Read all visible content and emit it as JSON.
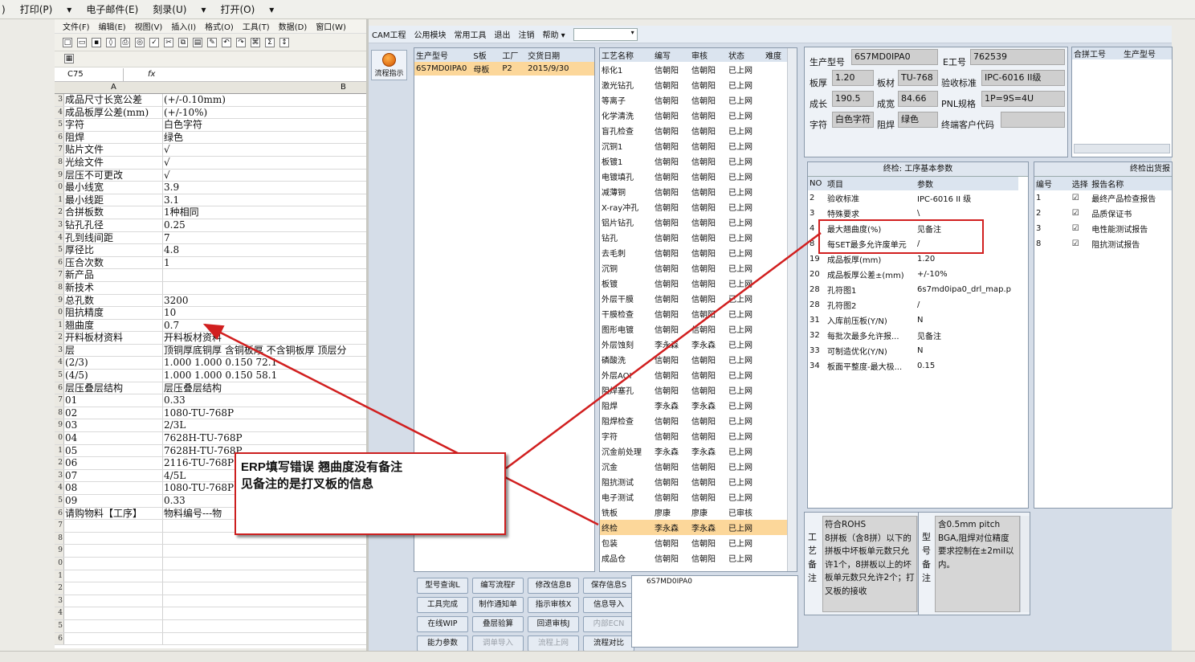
{
  "topbar": {
    "items": [
      ")",
      "打印(P)",
      "▾",
      "电子邮件(E)",
      "刻录(U)",
      "▾",
      "打开(O)",
      "▾"
    ]
  },
  "excel": {
    "menu": [
      "文件(F)",
      "编辑(E)",
      "视图(V)",
      "插入(I)",
      "格式(O)",
      "工具(T)",
      "数据(D)",
      "窗口(W)"
    ],
    "namebox": "C75",
    "fx": "fx",
    "col_a": "A",
    "col_b": "B",
    "rows": [
      {
        "n": "3",
        "a": "成品尺寸长宽公差",
        "b": "(+/-0.10mm)"
      },
      {
        "n": "4",
        "a": "成品板厚公差(mm)",
        "b": "(+/-10%)"
      },
      {
        "n": "5",
        "a": "字符",
        "b": "白色字符"
      },
      {
        "n": "6",
        "a": "阻焊",
        "b": "绿色"
      },
      {
        "n": "7",
        "a": "贴片文件",
        "b": "√"
      },
      {
        "n": "8",
        "a": "光绘文件",
        "b": "√"
      },
      {
        "n": "9",
        "a": "层压不可更改",
        "b": "√"
      },
      {
        "n": "0",
        "a": "最小线宽",
        "b": "3.9"
      },
      {
        "n": "1",
        "a": "最小线距",
        "b": "3.1"
      },
      {
        "n": "2",
        "a": "合拼板数",
        "b": "1种相同"
      },
      {
        "n": "3",
        "a": "钻孔孔径",
        "b": "0.25"
      },
      {
        "n": "4",
        "a": "孔到线间距",
        "b": "7"
      },
      {
        "n": "5",
        "a": "厚径比",
        "b": "4.8"
      },
      {
        "n": "6",
        "a": "压合次数",
        "b": "1"
      },
      {
        "n": "7",
        "a": "新产品",
        "b": ""
      },
      {
        "n": "8",
        "a": "新技术",
        "b": ""
      },
      {
        "n": "9",
        "a": "总孔数",
        "b": "3200"
      },
      {
        "n": "0",
        "a": "阻抗精度",
        "b": "10"
      },
      {
        "n": "1",
        "a": "翘曲度",
        "b": "0.7"
      },
      {
        "n": "2",
        "a": "开料板材资料",
        "b": "开料板材资料"
      },
      {
        "n": "3",
        "a": "层",
        "b": "顶铜厚底铜厚 含铜板厚 不含铜板厚 顶层分"
      },
      {
        "n": "4",
        "a": "(2/3)",
        "b": "1.000  1.000        0.150        72.1"
      },
      {
        "n": "5",
        "a": "(4/5)",
        "b": "1.000  1.000        0.150        58.1"
      },
      {
        "n": "6",
        "a": "层压叠层结构",
        "b": "层压叠层结构"
      },
      {
        "n": "7",
        "a": "01",
        "b": "0.33"
      },
      {
        "n": "8",
        "a": "02",
        "b": "1080-TU-768P"
      },
      {
        "n": "9",
        "a": "03",
        "b": "2/3L"
      },
      {
        "n": "0",
        "a": "04",
        "b": "7628H-TU-768P"
      },
      {
        "n": "1",
        "a": "05",
        "b": "7628H-TU-768P"
      },
      {
        "n": "2",
        "a": "06",
        "b": "2116-TU-768P"
      },
      {
        "n": "3",
        "a": "07",
        "b": "4/5L"
      },
      {
        "n": "4",
        "a": "08",
        "b": "1080-TU-768P"
      },
      {
        "n": "5",
        "a": "09",
        "b": "0.33"
      },
      {
        "n": "6",
        "a": "请购物料【工序】",
        "b": "物料编号---物"
      },
      {
        "n": "7",
        "a": "",
        "b": ""
      },
      {
        "n": "8",
        "a": "",
        "b": ""
      },
      {
        "n": "9",
        "a": "",
        "b": ""
      },
      {
        "n": "0",
        "a": "",
        "b": ""
      },
      {
        "n": "1",
        "a": "",
        "b": ""
      },
      {
        "n": "2",
        "a": "",
        "b": ""
      },
      {
        "n": "3",
        "a": "",
        "b": ""
      },
      {
        "n": "4",
        "a": "",
        "b": ""
      },
      {
        "n": "5",
        "a": "",
        "b": ""
      },
      {
        "n": "6",
        "a": "",
        "b": ""
      }
    ]
  },
  "cam": {
    "menu": [
      "CAM工程",
      "公用模块",
      "常用工具",
      "退出",
      "注销",
      "帮助 ▾"
    ],
    "flow_btn": "流程指示",
    "orders": {
      "headers": [
        "生产型号",
        "S板",
        "工厂",
        "交货日期"
      ],
      "rows": [
        [
          "6S7MD0IPA0",
          "母板",
          "P2",
          "2015/9/30"
        ]
      ]
    },
    "process": {
      "headers": [
        "工艺名称",
        "编写",
        "审核",
        "状态",
        "难度"
      ],
      "rows": [
        [
          "标化1",
          "信朝阳",
          "信朝阳",
          "已上网",
          ""
        ],
        [
          "激光钻孔",
          "信朝阳",
          "信朝阳",
          "已上网",
          ""
        ],
        [
          "等离子",
          "信朝阳",
          "信朝阳",
          "已上网",
          ""
        ],
        [
          "化学清洗",
          "信朝阳",
          "信朝阳",
          "已上网",
          ""
        ],
        [
          "盲孔检查",
          "信朝阳",
          "信朝阳",
          "已上网",
          ""
        ],
        [
          "沉铜1",
          "信朝阳",
          "信朝阳",
          "已上网",
          ""
        ],
        [
          "板镀1",
          "信朝阳",
          "信朝阳",
          "已上网",
          ""
        ],
        [
          "电镀填孔",
          "信朝阳",
          "信朝阳",
          "已上网",
          ""
        ],
        [
          "减薄铜",
          "信朝阳",
          "信朝阳",
          "已上网",
          ""
        ],
        [
          "X-ray冲孔",
          "信朝阳",
          "信朝阳",
          "已上网",
          ""
        ],
        [
          "铝片钻孔",
          "信朝阳",
          "信朝阳",
          "已上网",
          ""
        ],
        [
          "钻孔",
          "信朝阳",
          "信朝阳",
          "已上网",
          ""
        ],
        [
          "去毛刺",
          "信朝阳",
          "信朝阳",
          "已上网",
          ""
        ],
        [
          "沉铜",
          "信朝阳",
          "信朝阳",
          "已上网",
          ""
        ],
        [
          "板镀",
          "信朝阳",
          "信朝阳",
          "已上网",
          ""
        ],
        [
          "外层干膜",
          "信朝阳",
          "信朝阳",
          "已上网",
          ""
        ],
        [
          "干膜检查",
          "信朝阳",
          "信朝阳",
          "已上网",
          ""
        ],
        [
          "图形电镀",
          "信朝阳",
          "信朝阳",
          "已上网",
          ""
        ],
        [
          "外层蚀刻",
          "李永森",
          "李永森",
          "已上网",
          ""
        ],
        [
          "磷酸洗",
          "信朝阳",
          "信朝阳",
          "已上网",
          ""
        ],
        [
          "外层AOI",
          "信朝阳",
          "信朝阳",
          "已上网",
          ""
        ],
        [
          "阻焊塞孔",
          "信朝阳",
          "信朝阳",
          "已上网",
          ""
        ],
        [
          "阻焊",
          "李永森",
          "李永森",
          "已上网",
          ""
        ],
        [
          "阻焊检查",
          "信朝阳",
          "信朝阳",
          "已上网",
          ""
        ],
        [
          "字符",
          "信朝阳",
          "信朝阳",
          "已上网",
          ""
        ],
        [
          "沉金前处理",
          "李永森",
          "李永森",
          "已上网",
          ""
        ],
        [
          "沉金",
          "信朝阳",
          "信朝阳",
          "已上网",
          ""
        ],
        [
          "阻抗测试",
          "信朝阳",
          "信朝阳",
          "已上网",
          ""
        ],
        [
          "电子测试",
          "信朝阳",
          "信朝阳",
          "已上网",
          ""
        ],
        [
          "铣板",
          "廖康",
          "廖康",
          "已审核",
          ""
        ],
        [
          "终检",
          "李永森",
          "李永森",
          "已上网",
          ""
        ],
        [
          "包装",
          "信朝阳",
          "信朝阳",
          "已上网",
          ""
        ],
        [
          "成品仓",
          "信朝阳",
          "信朝阳",
          "已上网",
          ""
        ]
      ],
      "selected": 30
    },
    "buttons": [
      [
        "型号查询L",
        "编写流程F",
        "修改信息B",
        "保存信息S"
      ],
      [
        "工具完成",
        "制作通知单",
        "指示审核X",
        "信息导入"
      ],
      [
        "在线WIP",
        "叠层验算",
        "回退审核J",
        "内部ECN"
      ],
      [
        "能力参数",
        "调单导入",
        "流程上网",
        "流程对比"
      ]
    ],
    "disabled": [
      "内部ECN",
      "调单导入",
      "流程上网"
    ],
    "model_box": "6S7MD0IPA0",
    "info": {
      "prod_model_label": "生产型号",
      "prod_model": "6S7MD0IPA0",
      "e_label": "E工号",
      "e_val": "762539",
      "thick_label": "板厚",
      "thick": "1.20",
      "mat_label": "板材",
      "mat": "TU-768",
      "std_label": "验收标准",
      "std": "IPC-6016 II级",
      "len_label": "成长",
      "len": "190.5",
      "wid_label": "成宽",
      "wid": "84.66",
      "pnl_label": "PNL规格",
      "pnl": "1P=9S=4U",
      "char_label": "字符",
      "char": "白色字符",
      "mask_label": "阻焊",
      "mask": "绿色",
      "cust_label": "终端客户代码",
      "cust": ""
    },
    "merge": {
      "headers": [
        "合拼工号",
        "生产型号"
      ]
    },
    "params": {
      "title": "终检: 工序基本参数",
      "headers": [
        "NO",
        "项目",
        "参数"
      ],
      "rows": [
        [
          "2",
          "验收标准",
          "IPC-6016 II 级"
        ],
        [
          "3",
          "特殊要求",
          "\\"
        ],
        [
          "4",
          "最大翘曲度(%)",
          "见备注"
        ],
        [
          "8",
          "每SET最多允许废单元",
          "/"
        ],
        [
          "19",
          "成品板厚(mm)",
          "1.20"
        ],
        [
          "20",
          "成品板厚公差±(mm)",
          "+/-10%"
        ],
        [
          "28",
          "孔符图1",
          "6s7md0ipa0_drl_map.p"
        ],
        [
          "28",
          "孔符图2",
          "/"
        ],
        [
          "31",
          "入库前压板(Y/N)",
          "N"
        ],
        [
          "32",
          "每批次最多允许报...",
          "见备注"
        ],
        [
          "33",
          "可制造优化(Y/N)",
          "N"
        ],
        [
          "34",
          "板面平整度-最大极...",
          "0.15"
        ]
      ]
    },
    "reports": {
      "title": "终检出货报",
      "headers": [
        "编号",
        "选择",
        "报告名称"
      ],
      "rows": [
        [
          "1",
          "☑",
          "最终产品检查报告"
        ],
        [
          "2",
          "☑",
          "品质保证书"
        ],
        [
          "3",
          "☑",
          "电性能测试报告"
        ],
        [
          "8",
          "☑",
          "阻抗测试报告"
        ]
      ]
    },
    "craft_label": "工艺备注",
    "craft_text": "符合ROHS\n8拼板（含8拼）以下的拼板中坏板单元数只允许1个，8拼板以上的坏板单元数只允许2个；打叉板的接收",
    "model_label": "型号备注",
    "model_text": "含0.5mm pitch BGA,阻焊对位精度要求控制在±2mil以内。"
  },
  "annotation": {
    "line1_bold": "ERP",
    "line1": "填写错误  翘曲度没有备注",
    "line2": "见备注的是打叉板的信息",
    "color": "#d11f1f"
  }
}
